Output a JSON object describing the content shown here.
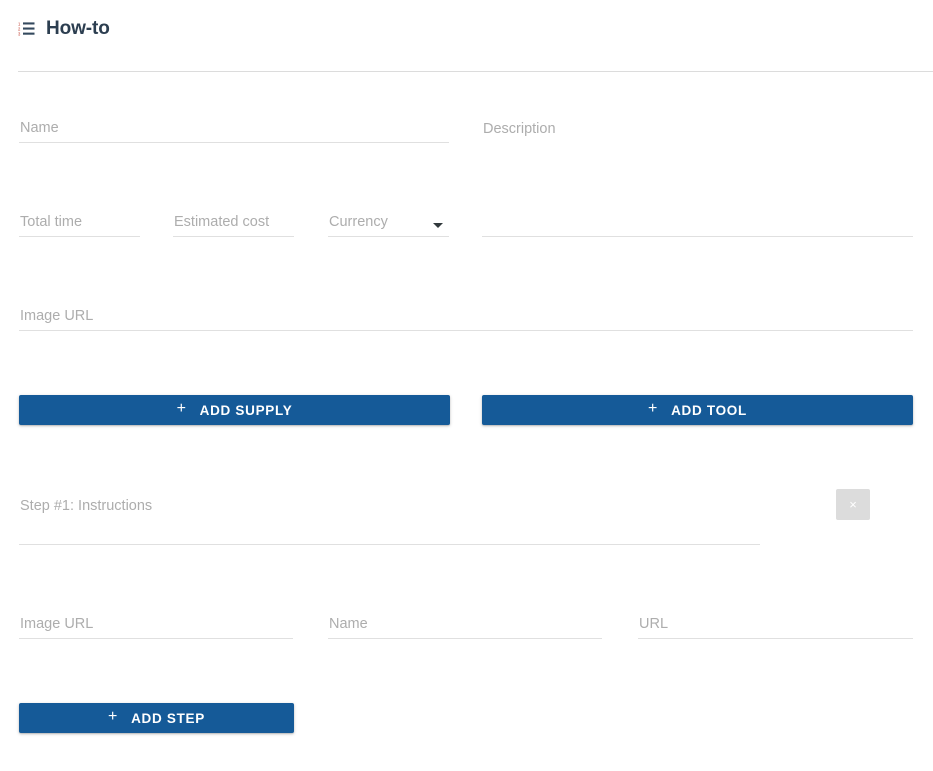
{
  "header": {
    "icon": "ordered-list-icon",
    "title": "How-to"
  },
  "form": {
    "name": {
      "placeholder": "Name",
      "value": ""
    },
    "description": {
      "placeholder": "Description",
      "value": ""
    },
    "total_time": {
      "placeholder": "Total time",
      "value": ""
    },
    "estimated_cost": {
      "placeholder": "Estimated cost",
      "value": ""
    },
    "currency": {
      "placeholder": "Currency",
      "selected": "Currency",
      "caret": "chevron-down-icon"
    },
    "image_url": {
      "placeholder": "Image URL",
      "value": ""
    }
  },
  "actions": {
    "add_supply": {
      "label": "Add supply",
      "icon": "plus-icon"
    },
    "add_tool": {
      "label": "Add tool",
      "icon": "plus-icon"
    },
    "add_step": {
      "label": "Add step",
      "icon": "plus-icon"
    }
  },
  "step": {
    "instructions": {
      "placeholder": "Step #1: Instructions",
      "value": ""
    },
    "remove": {
      "label": "×",
      "icon": "close-icon"
    },
    "image_url": {
      "placeholder": "Image URL",
      "value": ""
    },
    "name": {
      "placeholder": "Name",
      "value": ""
    },
    "url": {
      "placeholder": "URL",
      "value": ""
    }
  },
  "colors": {
    "primary": "#155a98",
    "title": "#2c3e50",
    "placeholder": "#adadad",
    "underline": "#e0e0e0",
    "delete_bg": "#dcdcdc"
  }
}
